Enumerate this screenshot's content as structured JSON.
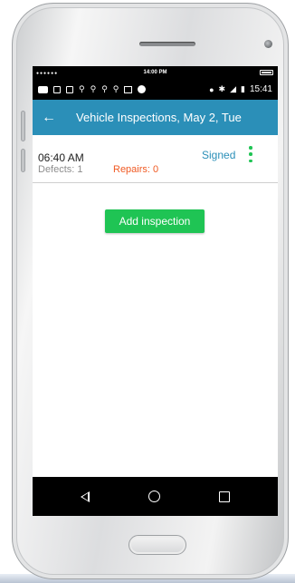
{
  "device": {
    "sim_clock": "14:00 PM",
    "status_time": "15:41"
  },
  "appbar": {
    "title": "Vehicle Inspections, May 2, Tue"
  },
  "inspections": [
    {
      "time": "06:40 AM",
      "defects": "Defects: 1",
      "repairs": "Repairs: 0",
      "status": "Signed"
    }
  ],
  "actions": {
    "add_inspection": "Add inspection"
  },
  "colors": {
    "appbar": "#2b8fb8",
    "primary_button": "#1fc454",
    "repairs_text": "#f05a23",
    "status_text": "#2b8fb8"
  }
}
